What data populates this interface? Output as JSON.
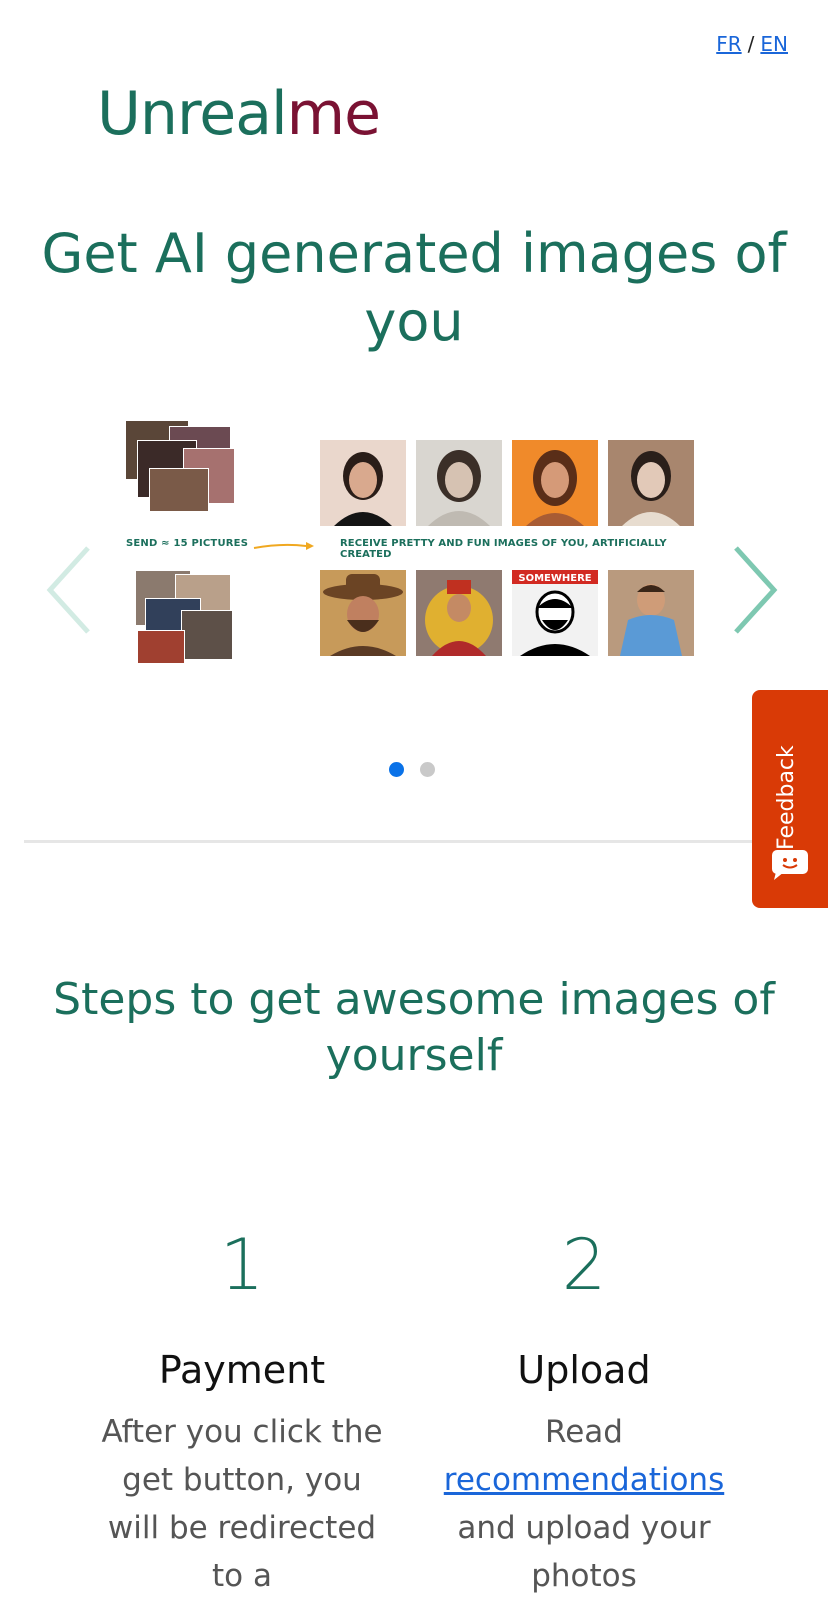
{
  "lang": {
    "fr": "FR",
    "separator": "/",
    "en": "EN"
  },
  "logo": {
    "part1": "Unreal",
    "part2": "me"
  },
  "hero": {
    "title": "Get AI generated images of you"
  },
  "carousel": {
    "send_label": "SEND ≈ 15 PICTURES",
    "receive_label": "RECEIVE PRETTY AND FUN IMAGES OF YOU, ARTIFICIALLY CREATED",
    "poster_text": "SOMEWHERE",
    "dots": 2,
    "active_dot": 0
  },
  "feedback": {
    "label": "Feedback"
  },
  "steps": {
    "title": "Steps to get awesome images of yourself",
    "items": [
      {
        "number": "1",
        "name": "Payment",
        "desc_pre": "After you click the get button, you will be redirected to a",
        "desc_link": "",
        "desc_post": ""
      },
      {
        "number": "2",
        "name": "Upload",
        "desc_pre": "Read",
        "desc_link": "recommendations",
        "desc_post": "and upload your photos"
      }
    ]
  },
  "colors": {
    "brand_green": "#1b6f5c",
    "brand_maroon": "#7a1233",
    "link": "#1a66d9",
    "feedback": "#d93a06",
    "dot_active": "#0a72e8"
  }
}
